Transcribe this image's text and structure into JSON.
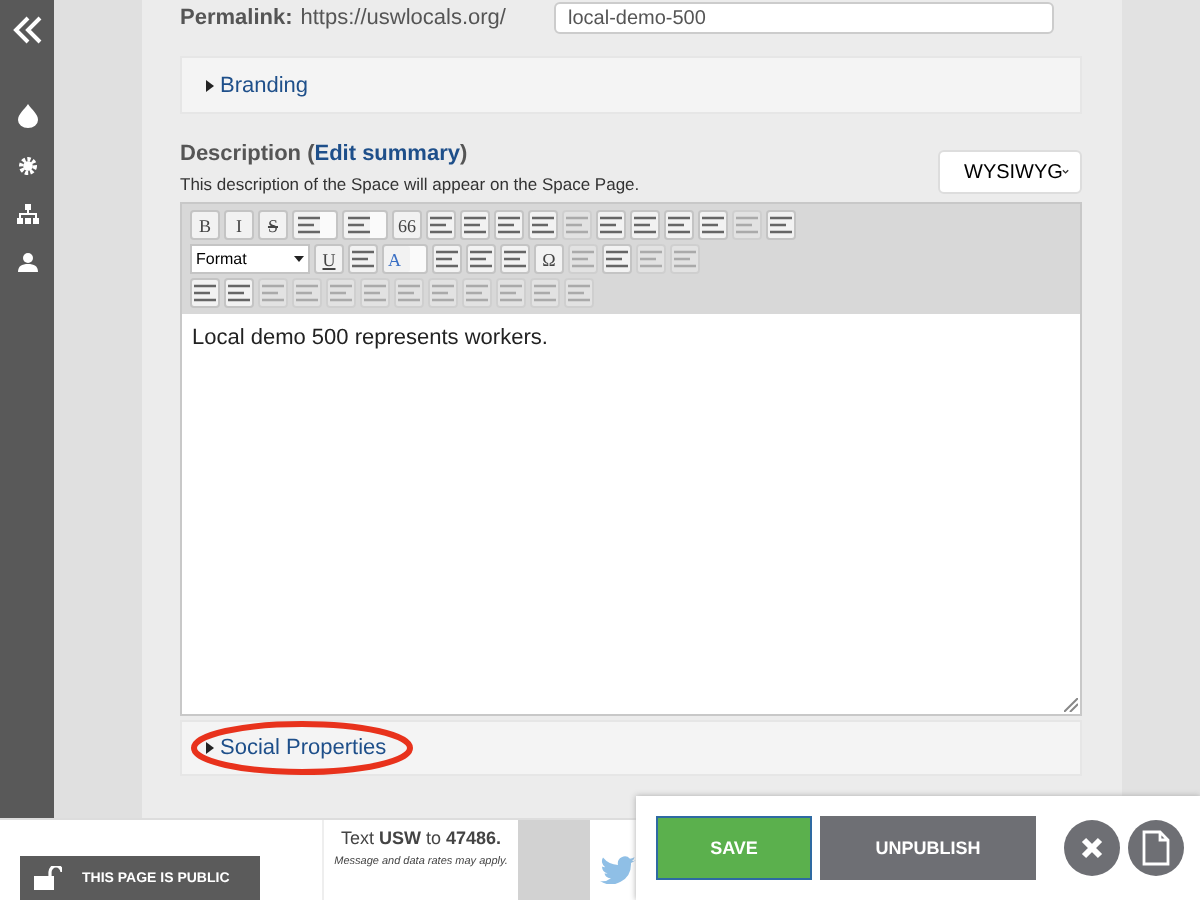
{
  "permalink": {
    "label": "Permalink:",
    "prefix": "https://uswlocals.org/",
    "value": "local-demo-500"
  },
  "sections": [
    {
      "label": "Branding",
      "expanded": false,
      "highlighted": false
    }
  ],
  "description": {
    "label": "Description (",
    "label_end": ")",
    "link": "Edit summary",
    "hint": "This description of the Space will appear on the Space Page.",
    "editor_mode": "WYSIWYG",
    "text": "Local demo 500 represents workers."
  },
  "toolbar": [
    [
      {
        "kind": "bold",
        "label": "B",
        "disabled": false
      },
      {
        "kind": "italic",
        "label": "I",
        "disabled": false
      },
      {
        "kind": "strike",
        "label": "S",
        "disabled": false
      },
      {
        "kind": "icon",
        "menu": true,
        "disabled": false
      },
      {
        "kind": "icon",
        "menu": true,
        "disabled": false
      },
      {
        "kind": "bold",
        "label": "66",
        "disabled": false
      },
      {
        "kind": "icon",
        "disabled": false
      },
      {
        "kind": "icon",
        "disabled": false
      },
      {
        "kind": "icon",
        "disabled": false
      },
      {
        "kind": "icon",
        "disabled": false
      },
      {
        "kind": "icon",
        "disabled": true
      },
      {
        "kind": "icon",
        "disabled": false
      },
      {
        "kind": "icon",
        "disabled": false
      },
      {
        "kind": "icon",
        "disabled": false
      },
      {
        "kind": "icon",
        "disabled": false
      },
      {
        "kind": "icon",
        "disabled": true
      },
      {
        "kind": "icon",
        "disabled": false
      }
    ],
    [
      {
        "kind": "select",
        "label": "Format",
        "disabled": false
      },
      {
        "kind": "underline",
        "label": "U",
        "disabled": false
      },
      {
        "kind": "icon",
        "disabled": false
      },
      {
        "kind": "color",
        "label": "A",
        "menu": true,
        "disabled": false
      },
      {
        "kind": "icon",
        "disabled": false
      },
      {
        "kind": "icon",
        "disabled": false
      },
      {
        "kind": "icon",
        "disabled": false
      },
      {
        "kind": "glyph",
        "label": "Ω",
        "disabled": false
      },
      {
        "kind": "icon",
        "disabled": true
      },
      {
        "kind": "icon",
        "disabled": false
      },
      {
        "kind": "icon",
        "disabled": true
      },
      {
        "kind": "icon",
        "disabled": true
      }
    ],
    [
      {
        "kind": "icon",
        "disabled": false
      },
      {
        "kind": "icon",
        "disabled": false
      },
      {
        "kind": "icon",
        "disabled": true
      },
      {
        "kind": "icon",
        "disabled": true
      },
      {
        "kind": "icon",
        "disabled": true
      },
      {
        "kind": "icon",
        "disabled": true
      },
      {
        "kind": "icon",
        "disabled": true
      },
      {
        "kind": "icon",
        "disabled": true
      },
      {
        "kind": "icon",
        "disabled": true
      },
      {
        "kind": "icon",
        "disabled": true
      },
      {
        "kind": "icon",
        "disabled": true
      },
      {
        "kind": "icon",
        "disabled": true
      }
    ]
  ],
  "social": {
    "label": "Social Properties",
    "expanded": false,
    "highlighted": true
  },
  "footer": {
    "public_badge": "THIS PAGE IS PUBLIC",
    "text_prefix": "Text",
    "keyword": "USW",
    "text_mid": "to",
    "number": "47486.",
    "disclaimer": "Message and data rates may apply."
  },
  "actions": {
    "save": "SAVE",
    "unpublish": "UNPUBLISH"
  }
}
